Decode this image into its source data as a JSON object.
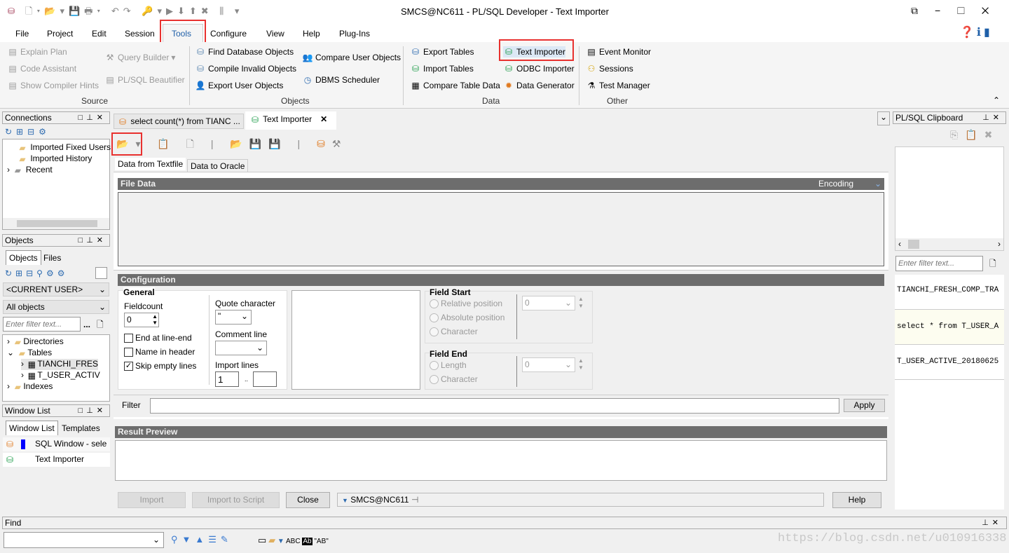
{
  "window": {
    "title": "SMCS@NC611 - PL/SQL Developer - Text Importer"
  },
  "menu": [
    "File",
    "Project",
    "Edit",
    "Session",
    "Tools",
    "Configure",
    "View",
    "Help",
    "Plug-Ins"
  ],
  "ribbon": {
    "source": {
      "label": "Source",
      "items": [
        "Explain Plan",
        "Code Assistant",
        "Show Compiler Hints",
        "Query Builder",
        "PL/SQL Beautifier"
      ]
    },
    "objects": {
      "label": "Objects",
      "items": [
        "Find Database Objects",
        "Compile Invalid Objects",
        "Export User Objects",
        "Compare User Objects",
        "DBMS Scheduler"
      ]
    },
    "data": {
      "label": "Data",
      "items": [
        "Export Tables",
        "Import Tables",
        "Compare Table Data",
        "Text Importer",
        "ODBC Importer",
        "Data Generator"
      ]
    },
    "other": {
      "label": "Other",
      "items": [
        "Event Monitor",
        "Sessions",
        "Test Manager"
      ]
    }
  },
  "connections": {
    "title": "Connections",
    "items": [
      "Imported Fixed Users",
      "Imported History",
      "Recent"
    ]
  },
  "objects_panel": {
    "title": "Objects",
    "tabs": [
      "Objects",
      "Files"
    ],
    "user": "<CURRENT USER>",
    "filter_type": "All objects",
    "filter_placeholder": "Enter filter text...",
    "tree": [
      "Directories",
      "Tables",
      "TIANCHI_FRES",
      "T_USER_ACTIV",
      "Indexes"
    ]
  },
  "window_list": {
    "title": "Window List",
    "tabs": [
      "Window List",
      "Templates"
    ],
    "items": [
      "SQL Window - sele",
      "Text Importer"
    ]
  },
  "doc_tabs": [
    "select count(*) from TIANC ...",
    "Text Importer"
  ],
  "importer": {
    "tabs": [
      "Data from Textfile",
      "Data to Oracle"
    ],
    "file_data": "File Data",
    "encoding": "Encoding",
    "configuration": "Configuration",
    "general": "General",
    "fieldcount_label": "Fieldcount",
    "fieldcount": "0",
    "end_at_line_end": "End at line-end",
    "name_in_header": "Name in header",
    "skip_empty_lines": "Skip empty lines",
    "quote_label": "Quote character",
    "quote_value": "\"",
    "comment_label": "Comment line",
    "import_lines_label": "Import lines",
    "import_from": "1",
    "import_sep": "..",
    "field_start": "Field Start",
    "fs_options": [
      "Relative position",
      "Absolute position",
      "Character"
    ],
    "fs_value": "0",
    "field_end": "Field End",
    "fe_options": [
      "Length",
      "Character"
    ],
    "fe_value": "0",
    "filter_label": "Filter",
    "apply": "Apply",
    "result_preview": "Result Preview",
    "buttons": {
      "import": "Import",
      "import_script": "Import to Script",
      "close": "Close",
      "help": "Help"
    },
    "connection": "SMCS@NC611"
  },
  "clipboard": {
    "title": "PL/SQL Clipboard",
    "filter_placeholder": "Enter filter text...",
    "items": [
      "TIANCHI_FRESH_COMP_TRA",
      "select * from T_USER_A",
      "T_USER_ACTIVE_20180625"
    ]
  },
  "find": {
    "title": "Find",
    "tools": [
      "ABC",
      "Ab",
      "\"AB\""
    ]
  },
  "watermark": "https://blog.csdn.net/u010916338"
}
